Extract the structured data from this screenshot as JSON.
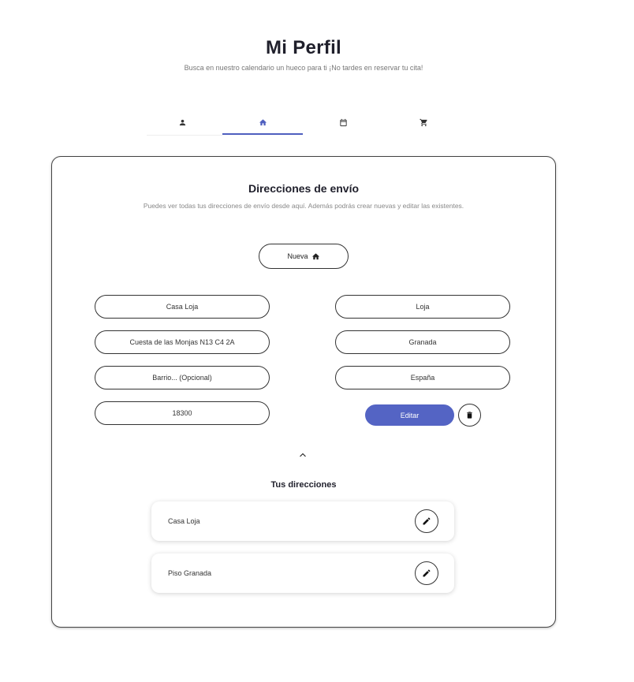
{
  "header": {
    "title": "Mi Perfil",
    "subtitle": "Busca en nuestro calendario un hueco para ti ¡No tardes en reservar tu cita!"
  },
  "tabs": [
    {
      "icon": "person-icon",
      "active": false
    },
    {
      "icon": "home-icon",
      "active": true
    },
    {
      "icon": "calendar-icon",
      "active": false
    },
    {
      "icon": "cart-icon",
      "active": false
    }
  ],
  "colors": {
    "accent": "#5464c4",
    "text": "#1f1f2b",
    "muted": "#888888"
  },
  "card": {
    "title": "Direcciones de envío",
    "subtitle": "Puedes ver todas tus direcciones de envío desde aquí. Además podrás crear nuevas y editar las existentes.",
    "new_button_label": "Nueva",
    "form": {
      "name": {
        "value": "Casa Loja"
      },
      "street": {
        "value": "Cuesta de las Monjas N13 C4 2A"
      },
      "district": {
        "value": "",
        "placeholder": "Barrio... (Opcional)"
      },
      "postal_code": {
        "value": "18300"
      },
      "city": {
        "value": "Loja"
      },
      "province": {
        "value": "Granada"
      },
      "country": {
        "value": "España"
      }
    },
    "edit_button_label": "Editar",
    "addresses_title": "Tus direcciones",
    "addresses": [
      {
        "name": "Casa Loja"
      },
      {
        "name": "Piso Granada"
      }
    ]
  }
}
